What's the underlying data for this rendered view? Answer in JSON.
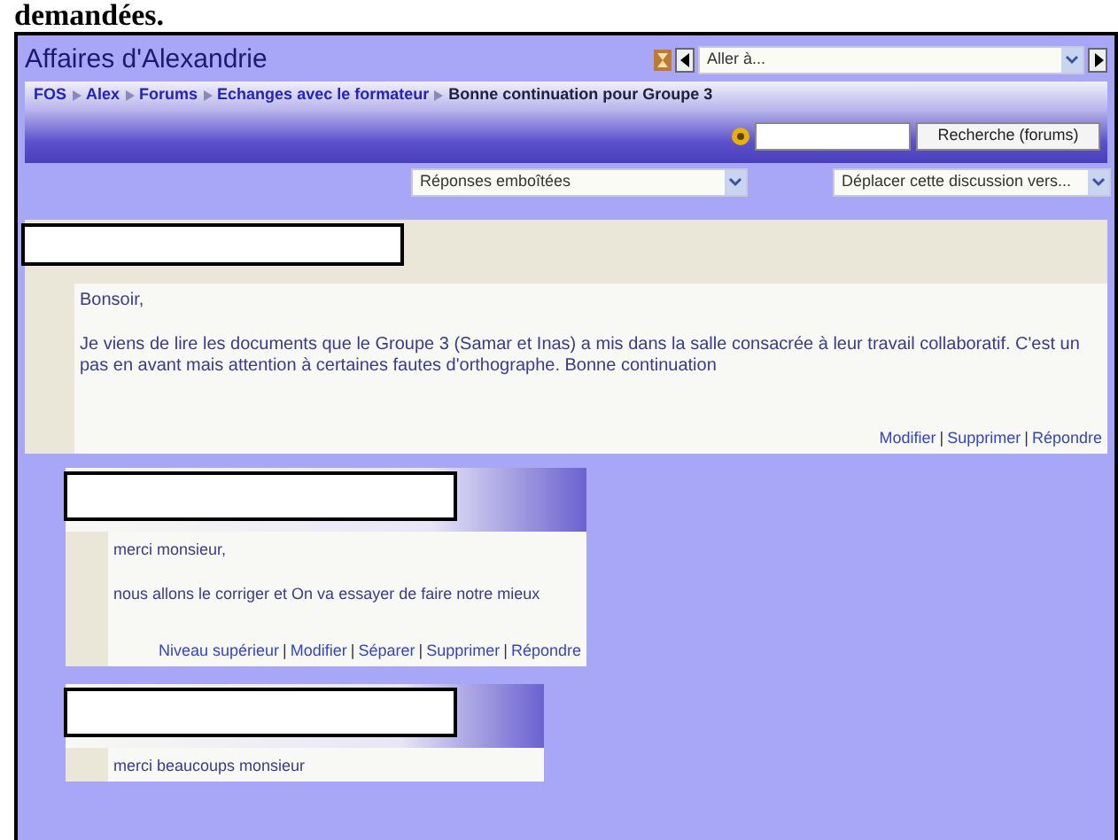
{
  "caption": "demandées.",
  "course_title": "Affaires d'Alexandrie",
  "jump_menu": {
    "value": "Aller à..."
  },
  "breadcrumb": [
    {
      "label": "FOS",
      "kind": "link"
    },
    {
      "label": "Alex",
      "kind": "link"
    },
    {
      "label": "Forums",
      "kind": "link"
    },
    {
      "label": "Echanges avec le formateur",
      "kind": "link"
    },
    {
      "label": "Bonne continuation pour Groupe 3",
      "kind": "current"
    }
  ],
  "search": {
    "button": "Recherche (forums)"
  },
  "display_mode": {
    "value": "Réponses emboîtées"
  },
  "move_discussion": {
    "value": "Déplacer cette discussion vers..."
  },
  "posts": [
    {
      "kind": "parent",
      "paragraphs": [
        "Bonsoir,",
        "Je viens de lire les documents que le Groupe 3 (Samar et Inas) a mis dans la salle consacrée à leur travail collaboratif. C'est un pas en avant mais attention à certaines fautes d'orthographe.  Bonne continuation"
      ],
      "actions": [
        "Modifier",
        "Supprimer",
        "Répondre"
      ]
    },
    {
      "kind": "reply",
      "paragraphs": [
        "merci monsieur,",
        "nous allons le corriger et On va essayer de faire notre mieux"
      ],
      "actions": [
        "Niveau supérieur",
        "Modifier",
        "Séparer",
        "Supprimer",
        "Répondre"
      ]
    },
    {
      "kind": "reply-cut",
      "paragraphs": [
        "merci beaucoups monsieur"
      ]
    }
  ],
  "action_separator": "|"
}
